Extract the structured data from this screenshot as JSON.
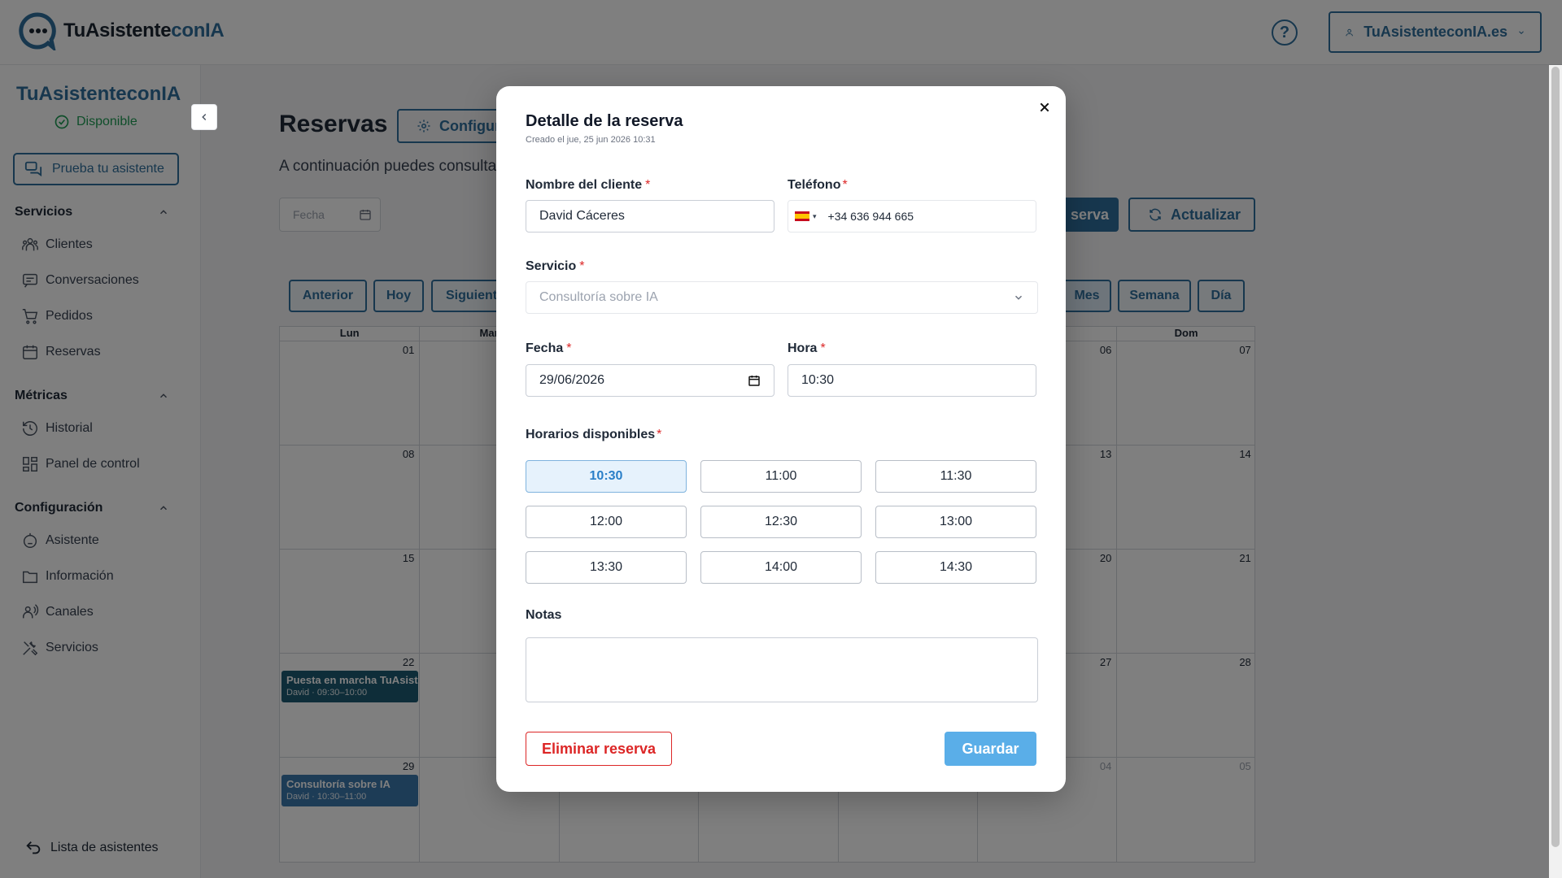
{
  "header": {
    "logo_main": "TuAsistente",
    "logo_accent": "conIA",
    "help_label": "?",
    "account_label": "TuAsistenteconIA.es"
  },
  "sidebar": {
    "title": "TuAsistenteconIA",
    "status": "Disponible",
    "try_button": "Prueba tu asistente",
    "sections": [
      {
        "label": "Servicios",
        "items": [
          {
            "label": "Clientes",
            "icon": "users-icon"
          },
          {
            "label": "Conversaciones",
            "icon": "chat-icon"
          },
          {
            "label": "Pedidos",
            "icon": "cart-icon"
          },
          {
            "label": "Reservas",
            "icon": "calendar-icon"
          }
        ]
      },
      {
        "label": "Métricas",
        "items": [
          {
            "label": "Historial",
            "icon": "history-icon"
          },
          {
            "label": "Panel de control",
            "icon": "dashboard-icon"
          }
        ]
      },
      {
        "label": "Configuración",
        "items": [
          {
            "label": "Asistente",
            "icon": "robot-icon"
          },
          {
            "label": "Información",
            "icon": "folder-icon"
          },
          {
            "label": "Canales",
            "icon": "channels-icon"
          },
          {
            "label": "Servicios",
            "icon": "tools-icon"
          }
        ]
      }
    ],
    "footer": "Lista de asistentes"
  },
  "main": {
    "title": "Reservas",
    "config_button": "Configura",
    "description": "A continuación puedes consultar",
    "date_placeholder": "Fecha",
    "new_button": "serva",
    "refresh_button": "Actualizar",
    "nav": {
      "prev": "Anterior",
      "today": "Hoy",
      "next": "Siguiente"
    },
    "views": {
      "month": "Mes",
      "week": "Semana",
      "day": "Día"
    },
    "calendar": {
      "headers": [
        "Lun",
        "Mar",
        "",
        "",
        "",
        "",
        "Dom"
      ],
      "rows": [
        [
          "01",
          "",
          "",
          "",
          "",
          "06",
          "07"
        ],
        [
          "08",
          "",
          "",
          "",
          "",
          "13",
          "14"
        ],
        [
          "15",
          "",
          "",
          "",
          "",
          "20",
          "21"
        ],
        [
          "22",
          "",
          "",
          "",
          "",
          "27",
          "28"
        ],
        [
          "29",
          "",
          "",
          "",
          "",
          "04",
          "05"
        ]
      ],
      "muted": [
        [
          4,
          5
        ],
        [
          4,
          6
        ]
      ],
      "events": [
        {
          "row": 3,
          "col": 0,
          "title": "Puesta en marcha TuAsistenteconIA",
          "sub": "David · 09:30–10:00",
          "color": "#1d5a73"
        },
        {
          "row": 4,
          "col": 0,
          "title": "Consultoría sobre IA",
          "sub": "David · 10:30–11:00",
          "color": "#3a79ad"
        }
      ]
    }
  },
  "modal": {
    "title": "Detalle de la reserva",
    "subtitle": "Creado el jue, 25 jun 2026 10:31",
    "client_label": "Nombre del cliente",
    "client_value": "David Cáceres",
    "phone_label": "Teléfono",
    "phone_value": "+34 636 944 665",
    "service_label": "Servicio",
    "service_value": "Consultoría sobre IA",
    "date_label": "Fecha",
    "date_value": "29/06/2026",
    "time_label": "Hora",
    "time_value": "10:30",
    "slots_label": "Horarios disponibles",
    "slots": [
      "10:30",
      "11:00",
      "11:30",
      "12:00",
      "12:30",
      "13:00",
      "13:30",
      "14:00",
      "14:30"
    ],
    "selected_slot": "10:30",
    "notes_label": "Notas",
    "notes_value": "",
    "delete_button": "Eliminar reserva",
    "save_button": "Guardar",
    "required_mark": "*"
  },
  "colors": {
    "brand": "#2f6f9c",
    "danger": "#dc2626",
    "save": "#5aaee8",
    "success": "#1f9d55"
  }
}
